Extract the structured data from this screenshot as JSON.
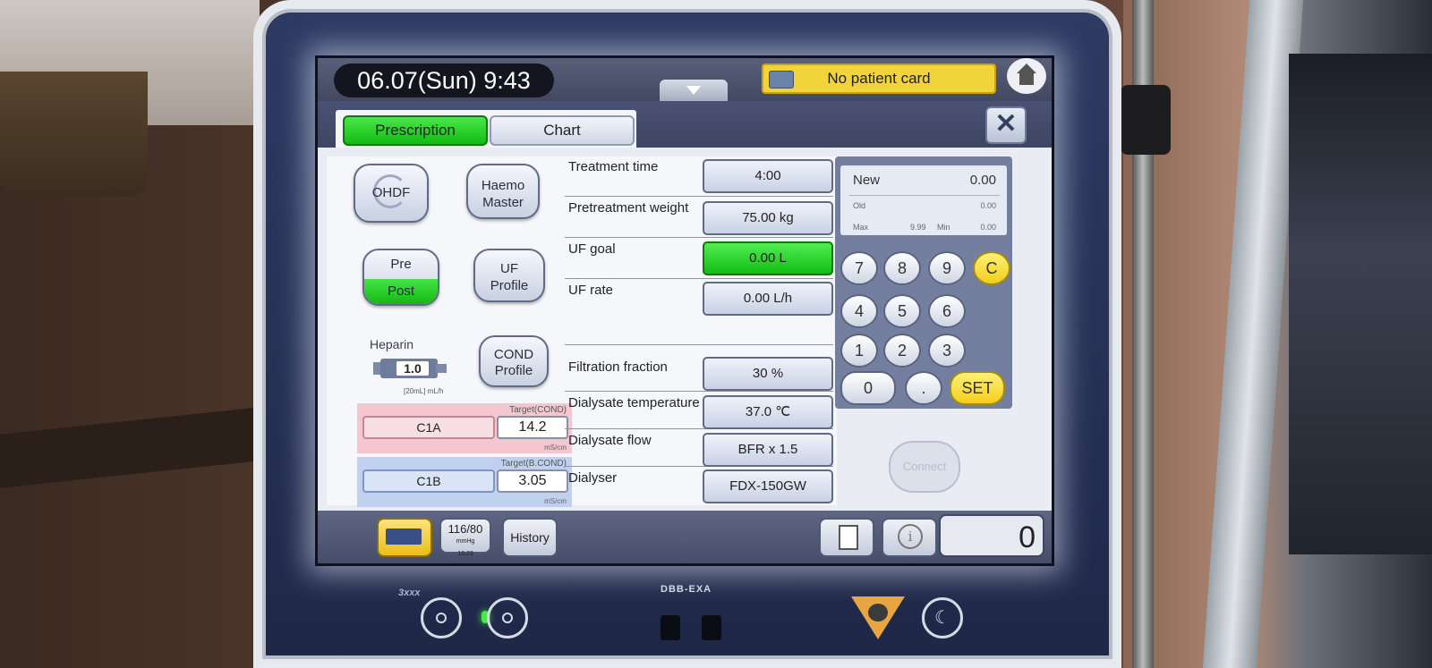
{
  "header": {
    "datetime": "06.07(Sun)  9:43",
    "patient_card": "No patient card"
  },
  "tabs": [
    {
      "label": "Prescription",
      "active": true
    },
    {
      "label": "Chart",
      "active": false
    }
  ],
  "modes": {
    "ohdf": "OHDF",
    "haemo_master_line1": "Haemo",
    "haemo_master_line2": "Master",
    "pre": "Pre",
    "post": "Post",
    "uf_profile_line1": "UF",
    "uf_profile_line2": "Profile",
    "cond_profile_line1": "COND",
    "cond_profile_line2": "Profile"
  },
  "heparin": {
    "label": "Heparin",
    "value": "1.0",
    "unit": "[20mL] mL/h"
  },
  "conductivity": {
    "a": {
      "name": "C1A",
      "target_label": "Target(COND)",
      "value": "14.2",
      "unit": "mS/cm"
    },
    "b": {
      "name": "C1B",
      "target_label": "Target(B.COND)",
      "value": "3.05",
      "unit": "mS/cm"
    }
  },
  "params": [
    {
      "label": "Treatment time",
      "value": "4:00"
    },
    {
      "label": "Pretreatment weight",
      "value": "75.00 kg"
    },
    {
      "label": "UF goal",
      "value": "0.00 L"
    },
    {
      "label": "UF rate",
      "value": "0.00 L/h"
    },
    {
      "label": "Filtration fraction",
      "value": "30 %"
    },
    {
      "label": "Dialysate temperature",
      "value": "37.0 ℃"
    },
    {
      "label": "Dialysate flow",
      "value": "BFR x 1.5"
    },
    {
      "label": "Dialyser",
      "value": "FDX-150GW"
    }
  ],
  "keypad": {
    "new_label": "New",
    "new_value": "0.00",
    "old_label": "Old",
    "old_value": "0.00",
    "max_label": "Max",
    "max_value": "9.99",
    "min_label": "Min",
    "min_value": "0.00",
    "keys": [
      "7",
      "8",
      "9",
      "C",
      "4",
      "5",
      "6",
      "1",
      "2",
      "3",
      "0",
      ".",
      "SET"
    ]
  },
  "connect_label": "Connect",
  "bottombar": {
    "bp": "116/80",
    "bp_unit": "mmHg",
    "bp_time": "13:23",
    "history": "History",
    "counter": "0"
  },
  "device": {
    "brand": "3xxx",
    "model": "DBB-EXA"
  },
  "colors": {
    "active_green": "#22cc22",
    "alert_yellow": "#f1d33a",
    "cond_a_pink": "#f4c6cf",
    "cond_b_blue": "#bfd1ef"
  }
}
